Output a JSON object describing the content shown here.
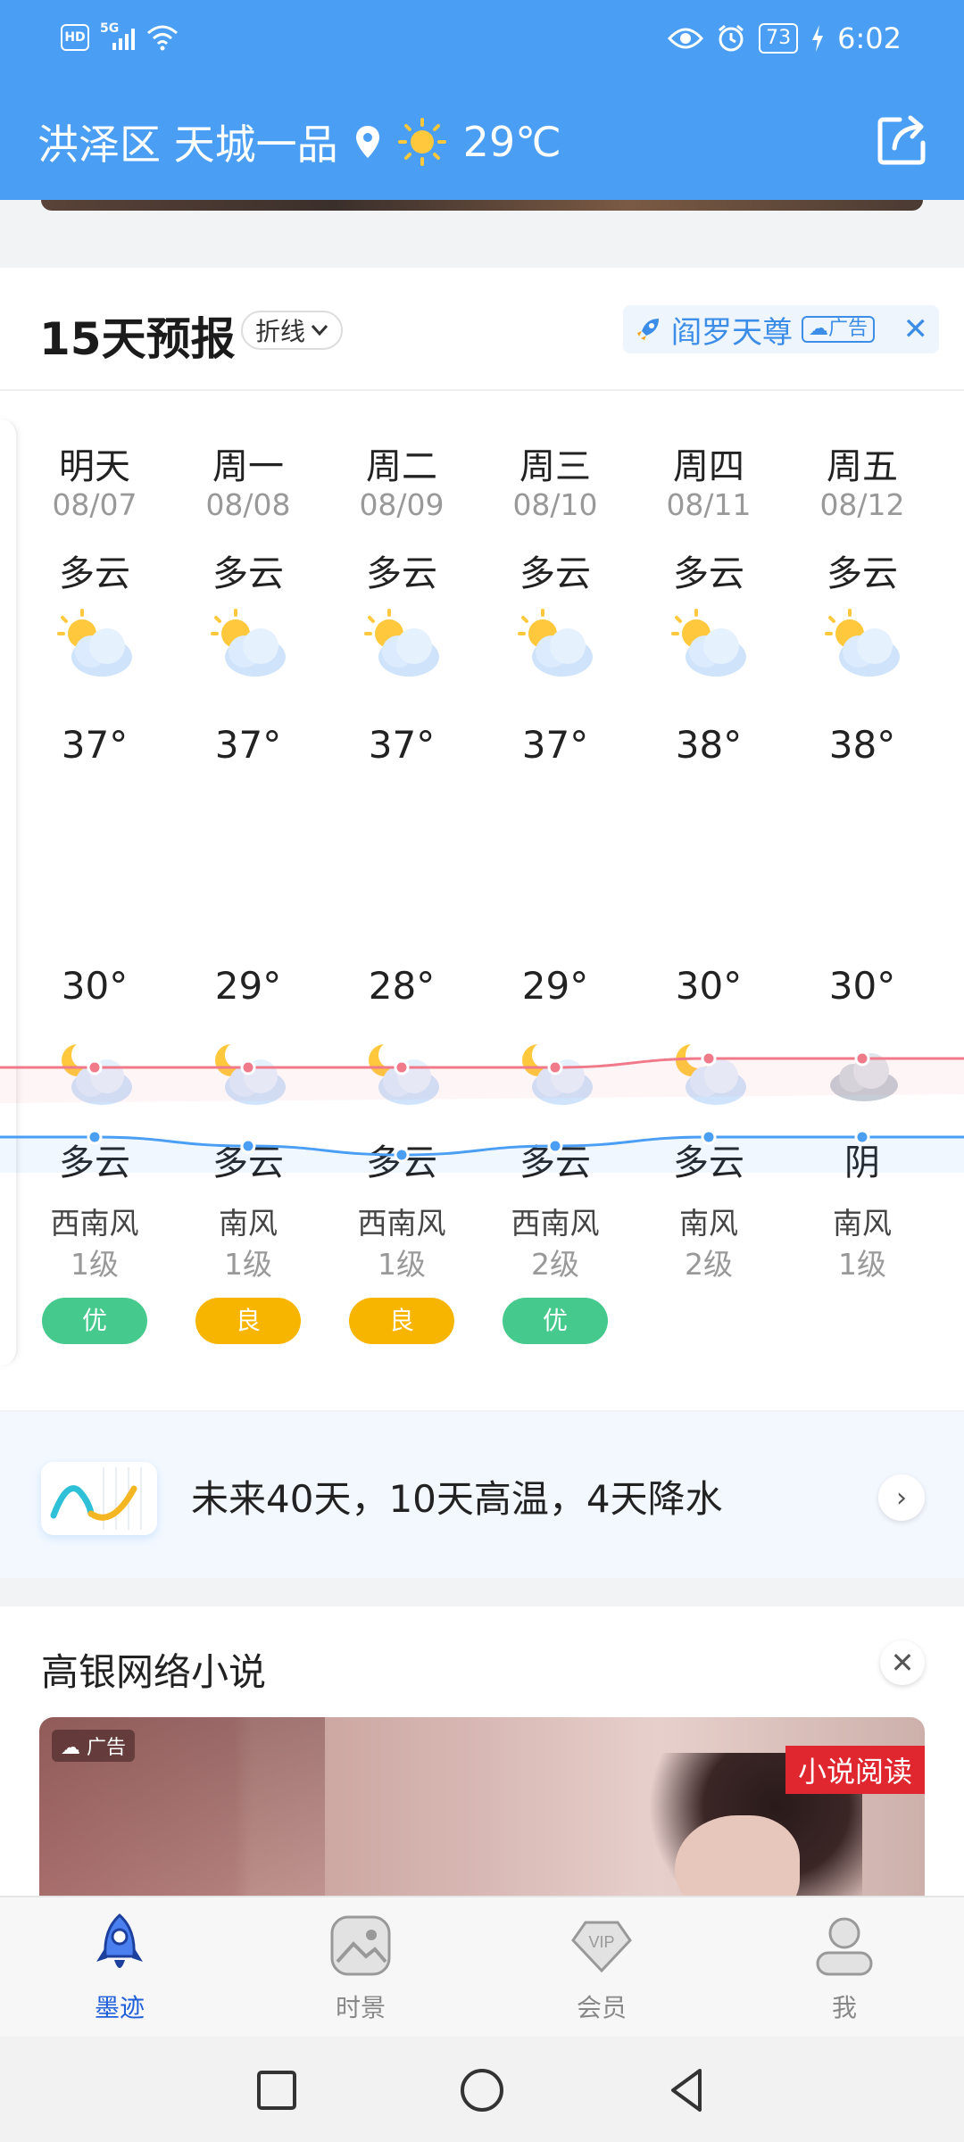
{
  "status_bar": {
    "left": {
      "hd": "HD",
      "network": "5G"
    },
    "battery": "73",
    "time": "6:02"
  },
  "header": {
    "location": "洪泽区 天城一品",
    "current_temp": "29℃"
  },
  "forecast": {
    "title": "15天预报",
    "mode": "折线",
    "ad": {
      "name": "阎罗天尊",
      "tag": "广告"
    },
    "days": [
      {
        "name": "明天",
        "date": "08/07",
        "day_cond": "多云",
        "high": "37°",
        "low": "30°",
        "night_cond": "多云",
        "night_icon": "moon-cloud-icon",
        "wind_dir": "西南风",
        "wind_lvl": "1级",
        "aqi": "优",
        "aqi_color": "#46c98c"
      },
      {
        "name": "周一",
        "date": "08/08",
        "day_cond": "多云",
        "high": "37°",
        "low": "29°",
        "night_cond": "多云",
        "night_icon": "moon-cloud-icon",
        "wind_dir": "南风",
        "wind_lvl": "1级",
        "aqi": "良",
        "aqi_color": "#f7b500"
      },
      {
        "name": "周二",
        "date": "08/09",
        "day_cond": "多云",
        "high": "37°",
        "low": "28°",
        "night_cond": "多云",
        "night_icon": "moon-cloud-icon",
        "wind_dir": "西南风",
        "wind_lvl": "1级",
        "aqi": "良",
        "aqi_color": "#f7b500"
      },
      {
        "name": "周三",
        "date": "08/10",
        "day_cond": "多云",
        "high": "37°",
        "low": "29°",
        "night_cond": "多云",
        "night_icon": "moon-cloud-icon",
        "wind_dir": "西南风",
        "wind_lvl": "2级",
        "aqi": "优",
        "aqi_color": "#46c98c"
      },
      {
        "name": "周四",
        "date": "08/11",
        "day_cond": "多云",
        "high": "38°",
        "low": "30°",
        "night_cond": "多云",
        "night_icon": "moon-cloud-icon",
        "wind_dir": "南风",
        "wind_lvl": "2级",
        "aqi": "",
        "aqi_color": ""
      },
      {
        "name": "周五",
        "date": "08/12",
        "day_cond": "多云",
        "high": "38°",
        "low": "30°",
        "night_cond": "阴",
        "night_icon": "overcast-cloud-icon",
        "wind_dir": "南风",
        "wind_lvl": "1级",
        "aqi": "",
        "aqi_color": ""
      }
    ],
    "high_values": [
      37,
      37,
      37,
      37,
      38,
      38
    ],
    "low_values": [
      30,
      29,
      28,
      29,
      30,
      30
    ],
    "high_color": "#f07a8a",
    "low_color": "#4a9ef4"
  },
  "trend": {
    "text": "未来40天，10天高温，4天降水"
  },
  "novel": {
    "title": "高银网络小说",
    "ad_tag": "广告",
    "label": "小说阅读"
  },
  "bottom_nav": [
    {
      "label": "墨迹",
      "icon": "rocket-icon",
      "active": true
    },
    {
      "label": "时景",
      "icon": "photo-icon",
      "active": false
    },
    {
      "label": "会员",
      "icon": "vip-icon",
      "active": false
    },
    {
      "label": "我",
      "icon": "user-icon",
      "active": false
    }
  ],
  "colors": {
    "header_bg": "#4a9ef4",
    "accent": "#1f5fd9"
  }
}
